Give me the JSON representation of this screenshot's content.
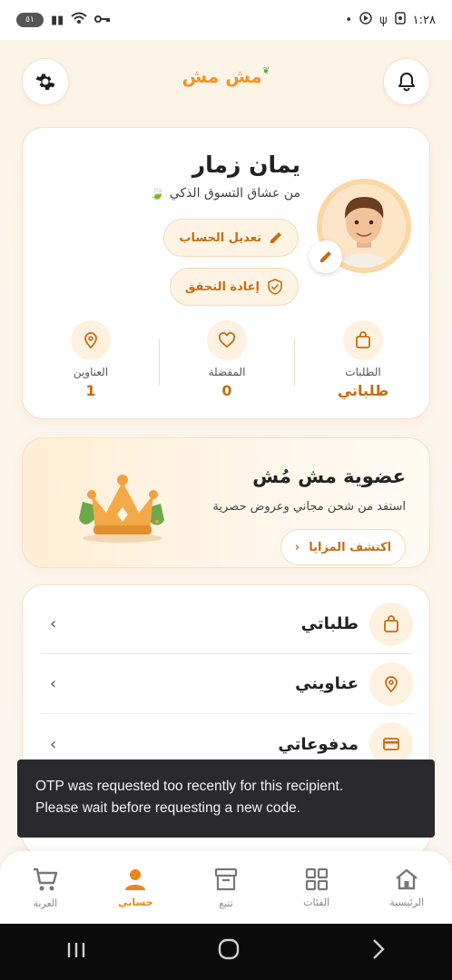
{
  "status_bar": {
    "time": "١:٢٨",
    "battery": "٥١"
  },
  "header": {
    "logo": "مش مش"
  },
  "profile": {
    "name": "يمان زمار",
    "subtitle": "من عشاق التسوق الذكي",
    "edit_account": "تعديل الحساب",
    "reverify": "إعادة التحقق",
    "stats": [
      {
        "label": "الطلبات",
        "value": "طلباتي",
        "icon": "bag-icon"
      },
      {
        "label": "المفضلة",
        "value": "0",
        "icon": "heart-icon"
      },
      {
        "label": "العناوين",
        "value": "1",
        "icon": "location-icon"
      }
    ]
  },
  "membership": {
    "title": "عضوية مش مُش",
    "subtitle": "استفد من شحن مجاني وعروض حصرية",
    "button": "اكتشف المزايا"
  },
  "menu": [
    {
      "label": "طلباتي",
      "icon": "bag-icon"
    },
    {
      "label": "عناويني",
      "icon": "location-icon"
    },
    {
      "label": "مدفوعاتي",
      "icon": "card-icon"
    }
  ],
  "toast": {
    "line1": "OTP was requested too recently for this recipient.",
    "line2": "Please wait before requesting a new code."
  },
  "bottom_nav": [
    {
      "label": "الرئيسية",
      "icon": "home-icon"
    },
    {
      "label": "الفئات",
      "icon": "grid-icon"
    },
    {
      "label": "تتبع",
      "icon": "archive-icon"
    },
    {
      "label": "حسابي",
      "icon": "person-icon",
      "active": true
    },
    {
      "label": "العربة",
      "icon": "cart-icon"
    }
  ],
  "colors": {
    "accent": "#e8871c",
    "accent_dark": "#c46d12",
    "toast_bg": "#2a2a2e"
  }
}
